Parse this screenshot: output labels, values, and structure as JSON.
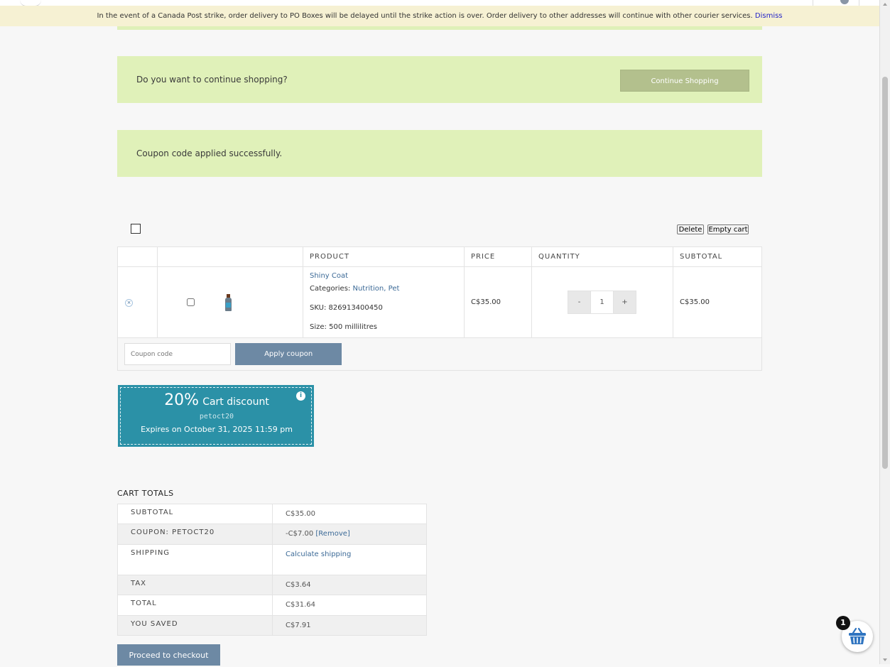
{
  "notice": {
    "text": "In the event of a Canada Post strike, order delivery to PO Boxes will be delayed until the strike action is over. Order delivery to other addresses will continue with other courier services.",
    "dismiss_label": "Dismiss"
  },
  "continue_box": {
    "message": "Do you want to continue shopping?",
    "button_label": "Continue Shopping"
  },
  "coupon_notice": {
    "message": "Coupon code applied successfully."
  },
  "cart_actions": {
    "delete_label": "Delete",
    "empty_label": "Empty cart"
  },
  "cart_table": {
    "headers": [
      "PRODUCT",
      "PRICE",
      "QUANTITY",
      "SUBTOTAL"
    ],
    "item": {
      "remove_icon": "×",
      "name": "Shiny Coat",
      "categories_label": "Categories:",
      "category_1": "Nutrition",
      "category_sep": ",",
      "category_2": "Pet",
      "sku": "SKU: 826913400450",
      "size_label": "Size:",
      "size_value": "500 millilitres",
      "price": "C$35.00",
      "qty_minus": "-",
      "quantity": "1",
      "qty_plus": "+",
      "subtotal": "C$35.00"
    },
    "coupon_placeholder": "Coupon code",
    "apply_label": "Apply coupon"
  },
  "coupon_card": {
    "amount": "20%",
    "label": "Cart discount",
    "code": "petoct20",
    "expires": "Expires on October 31, 2025 11:59 pm",
    "info_icon": "i"
  },
  "cart_totals": {
    "title": "CART TOTALS",
    "rows": [
      {
        "label": "SUBTOTAL",
        "value": "C$35.00"
      },
      {
        "label": "COUPON: PETOCT20",
        "value": "-C$7.00",
        "link": "[Remove]"
      },
      {
        "label": "SHIPPING",
        "value": "Calculate shipping"
      },
      {
        "label": "TAX",
        "value": "C$3.64"
      },
      {
        "label": "TOTAL",
        "value": "C$31.64"
      },
      {
        "label": "YOU SAVED",
        "value": "C$7.91"
      }
    ]
  },
  "checkout_label": "Proceed to checkout",
  "cart_fab": {
    "count": "1",
    "icon": "basket-icon"
  },
  "colors": {
    "accent": "#6d89a4",
    "green_notice": "#e0f1b9",
    "coupon_card": "#2b91a7",
    "link": "#3c6a97"
  }
}
